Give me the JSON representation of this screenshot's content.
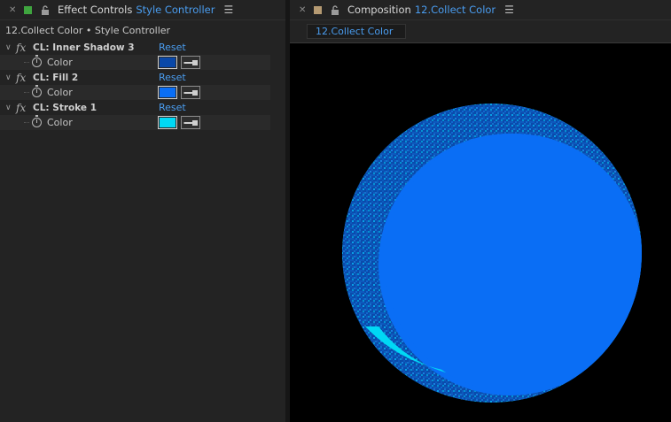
{
  "left_panel": {
    "title": "Effect Controls",
    "target": "Style Controller",
    "swatch_color": "#3fa53f",
    "breadcrumb": "12.Collect Color • Style Controller",
    "effects": [
      {
        "name": "CL: Inner Shadow 3",
        "reset": "Reset",
        "property": "Color",
        "color": "#0a48a8"
      },
      {
        "name": "CL: Fill 2",
        "reset": "Reset",
        "property": "Color",
        "color": "#0a6ef5"
      },
      {
        "name": "CL: Stroke 1",
        "reset": "Reset",
        "property": "Color",
        "color": "#00d8f5"
      }
    ]
  },
  "right_panel": {
    "title": "Composition",
    "target": "12.Collect Color",
    "swatch_color": "#b59a72",
    "tab_label": "12.Collect Color"
  },
  "icons": {
    "close": "close-icon",
    "lock": "lock-icon",
    "menu": "hamburger-menu-icon",
    "twirl": "chevron-down-icon",
    "fx": "fx-icon",
    "stopwatch": "stopwatch-icon",
    "eyedropper": "eyedropper-icon"
  }
}
